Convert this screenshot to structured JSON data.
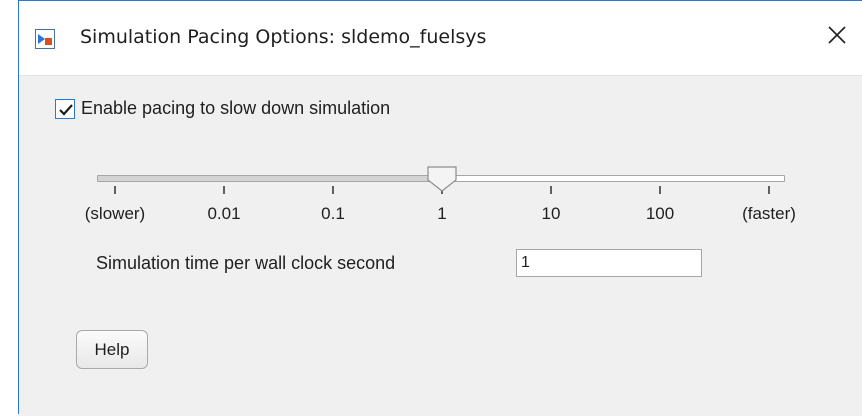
{
  "window": {
    "title": "Simulation Pacing Options: sldemo_fuelsys",
    "app_icon": "simulink-icon",
    "close_icon": "close-icon",
    "accent_color": "#2b78d4"
  },
  "pacing": {
    "enable_label": "Enable pacing to slow down simulation",
    "enabled": true
  },
  "slider": {
    "tick_labels": [
      "(slower)",
      "0.01",
      "0.1",
      "1",
      "10",
      "100",
      "(faster)"
    ],
    "selected_value": "1",
    "selected_tick_index": 3
  },
  "rate": {
    "label": "Simulation time per wall clock second",
    "value": "1"
  },
  "buttons": {
    "help_label": "Help"
  }
}
